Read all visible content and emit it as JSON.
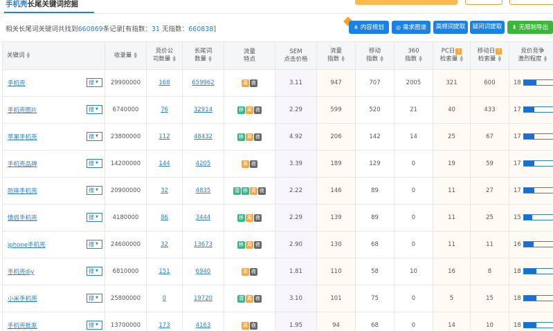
{
  "page": {
    "title_accent": "手机壳",
    "title_rest": "长尾关键词挖掘",
    "top_tab_a": "",
    "top_tab_b": "",
    "top_tab_c": ""
  },
  "summary": {
    "prefix": "相关长尾词关键词共找到",
    "total": "660869",
    "mid": "条记录[有指数：",
    "with_index": "31",
    "mid2": "  无指数：",
    "no_index": "660838",
    "suffix": "]"
  },
  "toolbar": {
    "content_plan": "内容规划",
    "demand_map": "需求图谱",
    "high_freq": "高频词提取",
    "question_words": "疑问词提取",
    "export": "无限制导出"
  },
  "columns": {
    "keyword": "关键词",
    "index_count": "收录量",
    "bid_companies_1": "竞价公",
    "bid_companies_2": "司数量",
    "longtail_1": "长尾词",
    "longtail_2": "数量",
    "traffic_feature_1": "流量",
    "traffic_feature_2": "特点",
    "sem_1": "SEM",
    "sem_2": "点击价格",
    "traffic_index_1": "流量",
    "traffic_index_2": "指数",
    "mobile_index_1": "移动",
    "mobile_index_2": "指数",
    "s360_1": "360",
    "s360_2": "指数",
    "pc_daily_1": "PC日",
    "pc_daily_2": "检索量",
    "mobile_daily_1": "移动日",
    "mobile_daily_2": "检索量",
    "competition_1": "竞价竞争",
    "competition_2": "激烈程度"
  },
  "search_label": "搜",
  "rows": [
    {
      "keyword": "手机壳",
      "index": "29900000",
      "bid": "168",
      "longtail": "659962",
      "tags": [
        "y",
        "n"
      ],
      "tag_text": [
        "周",
        "夜"
      ],
      "sem": "3.11",
      "traffic": "947",
      "mobile": "707",
      "s360": "2005",
      "pc": "321",
      "mdaily": "600",
      "comp": "18",
      "comp_fill": 0.3
    },
    {
      "keyword": "手机壳图片",
      "index": "6740000",
      "bid": "76",
      "longtail": "32914",
      "tags": [
        "g",
        "y",
        "n"
      ],
      "tag_text": [
        "移",
        "周",
        "夜"
      ],
      "sem": "2.29",
      "traffic": "599",
      "mobile": "520",
      "s360": "21",
      "pc": "40",
      "mdaily": "433",
      "comp": "17",
      "comp_fill": 0.26
    },
    {
      "keyword": "苹果手机壳",
      "index": "23800000",
      "bid": "112",
      "longtail": "48432",
      "tags": [
        "g",
        "y",
        "n"
      ],
      "tag_text": [
        "移",
        "周",
        "夜"
      ],
      "sem": "4.92",
      "traffic": "206",
      "mobile": "142",
      "s360": "14",
      "pc": "25",
      "mdaily": "67",
      "comp": "17",
      "comp_fill": 0.26
    },
    {
      "keyword": "手机壳品牌",
      "index": "14200000",
      "bid": "144",
      "longtail": "4205",
      "tags": [
        "y",
        "n"
      ],
      "tag_text": [
        "周",
        "夜"
      ],
      "sem": "3.39",
      "traffic": "189",
      "mobile": "129",
      "s360": "0",
      "pc": "19",
      "mdaily": "59",
      "comp": "17",
      "comp_fill": 0.26
    },
    {
      "keyword": "防摔手机壳",
      "index": "20900000",
      "bid": "32",
      "longtail": "4835",
      "tags": [
        "g",
        "g",
        "y",
        "n"
      ],
      "tag_text": [
        "潜",
        "移",
        "周",
        "夜"
      ],
      "sem": "2.22",
      "traffic": "146",
      "mobile": "89",
      "s360": "0",
      "pc": "11",
      "mdaily": "27",
      "comp": "17",
      "comp_fill": 0.26
    },
    {
      "keyword": "情侣手机壳",
      "index": "4180000",
      "bid": "86",
      "longtail": "3444",
      "tags": [
        "g",
        "y",
        "n"
      ],
      "tag_text": [
        "移",
        "周",
        "夜"
      ],
      "sem": "2.29",
      "traffic": "139",
      "mobile": "89",
      "s360": "0",
      "pc": "11",
      "mdaily": "25",
      "comp": "15",
      "comp_fill": 0.2
    },
    {
      "keyword": "iphone手机壳",
      "index": "24600000",
      "bid": "32",
      "longtail": "13673",
      "tags": [
        "g",
        "y",
        "n"
      ],
      "tag_text": [
        "移",
        "周",
        "夜"
      ],
      "sem": "2.90",
      "traffic": "130",
      "mobile": "68",
      "s360": "0",
      "pc": "11",
      "mdaily": "11",
      "comp": "16",
      "comp_fill": 0.23
    },
    {
      "keyword": "手机壳diy",
      "index": "6810000",
      "bid": "151",
      "longtail": "6940",
      "tags": [
        "y",
        "n"
      ],
      "tag_text": [
        "周",
        "夜"
      ],
      "sem": "1.81",
      "traffic": "110",
      "mobile": "58",
      "s360": "10",
      "pc": "16",
      "mdaily": "8",
      "comp": "18",
      "comp_fill": 0.3
    },
    {
      "keyword": "小米手机壳",
      "index": "25800000",
      "bid": "0",
      "longtail": "19720",
      "tags": [
        "g",
        "y",
        "n"
      ],
      "tag_text": [
        "潜",
        "周",
        "夜"
      ],
      "sem": "3.10",
      "traffic": "101",
      "mobile": "75",
      "s360": "0",
      "pc": "5",
      "mdaily": "15",
      "comp": "18",
      "comp_fill": 0.3
    },
    {
      "keyword": "手机壳批发",
      "index": "13700000",
      "bid": "173",
      "longtail": "4163",
      "tags": [
        "y",
        "n"
      ],
      "tag_text": [
        "周",
        "夜"
      ],
      "sem": "1.95",
      "traffic": "94",
      "mobile": "68",
      "s360": "0",
      "pc": "14",
      "mdaily": "10",
      "comp": "18",
      "comp_fill": 0.3
    }
  ]
}
